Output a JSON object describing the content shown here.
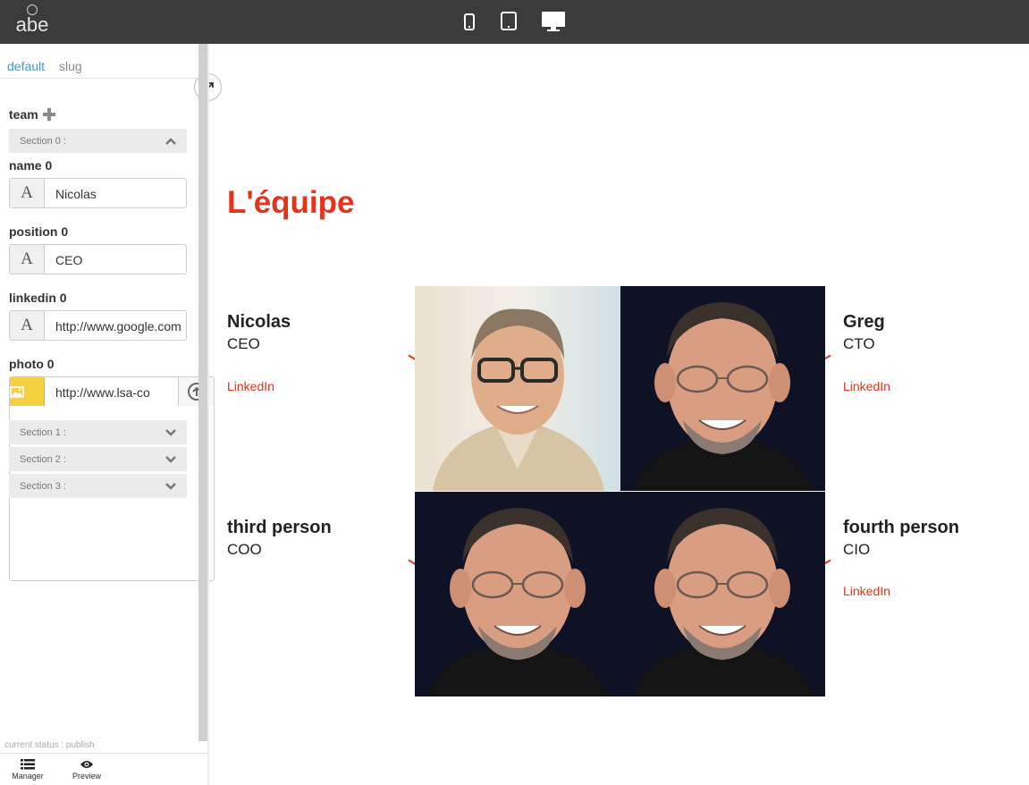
{
  "app": {
    "logo_text": "abe"
  },
  "devices": [
    {
      "name": "mobile"
    },
    {
      "name": "tablet"
    },
    {
      "name": "desktop",
      "active": true
    }
  ],
  "sidebar": {
    "tabs": [
      "default",
      "slug"
    ],
    "group": "team",
    "sections": [
      {
        "label": "Section 0 :",
        "expanded": true
      },
      {
        "label": "Section 1 :",
        "expanded": false
      },
      {
        "label": "Section 2 :",
        "expanded": false
      },
      {
        "label": "Section 3 :",
        "expanded": false
      }
    ],
    "fields": {
      "name": {
        "label": "name 0",
        "value": "Nicolas"
      },
      "position": {
        "label": "position 0",
        "value": "CEO"
      },
      "linkedin": {
        "label": "linkedin 0",
        "value": "http://www.google.com"
      },
      "photo": {
        "label": "photo 0",
        "value": "http://www.lsa-conso.fr"
      }
    },
    "status": "current status : publish",
    "nav": {
      "manager": "Manager",
      "preview": "Preview"
    }
  },
  "main": {
    "title": "L'équipe",
    "people": [
      {
        "name": "Nicolas",
        "position": "CEO",
        "link": "LinkedIn"
      },
      {
        "name": "Greg",
        "position": "CTO",
        "link": "LinkedIn"
      },
      {
        "name": "third person",
        "position": "COO",
        "link": ""
      },
      {
        "name": "fourth person",
        "position": "CIO",
        "link": "LinkedIn"
      }
    ]
  },
  "colors": {
    "accent": "#e5341c",
    "topbar": "#3b3b3b",
    "tab_active": "#3a9ad9",
    "photo_button": "#f5d142"
  }
}
